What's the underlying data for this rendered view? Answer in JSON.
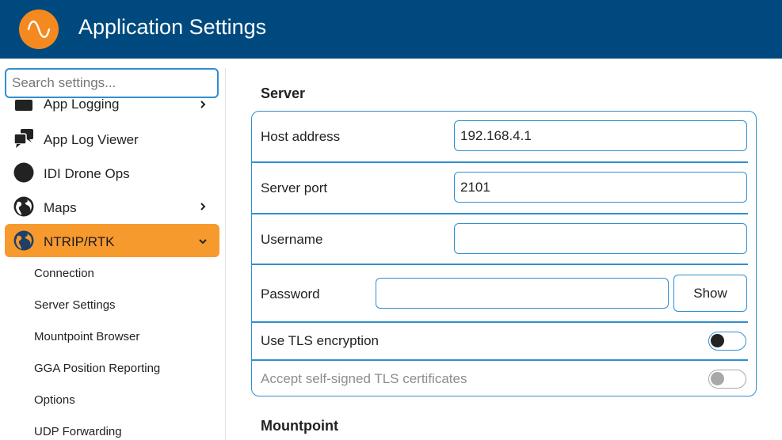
{
  "header": {
    "title": "Application Settings",
    "logo_icon": "sine-wave-icon",
    "bg_color": "#00497e",
    "logo_color": "#f48a1f"
  },
  "sidebar": {
    "search_placeholder": "Search settings...",
    "items": [
      {
        "label": "App Logging",
        "icon": "logging-icon",
        "has_chevron": true
      },
      {
        "label": "App Log Viewer",
        "icon": "chat-bubbles-icon",
        "has_chevron": false
      },
      {
        "label": "IDI Drone Ops",
        "icon": "circle-icon",
        "has_chevron": false
      },
      {
        "label": "Maps",
        "icon": "globe-icon",
        "has_chevron": true
      },
      {
        "label": "NTRIP/RTK",
        "icon": "globe-icon",
        "has_chevron": true,
        "expanded": true,
        "active": true
      }
    ],
    "subitems": [
      "Connection",
      "Server Settings",
      "Mountpoint Browser",
      "GGA Position Reporting",
      "Options",
      "UDP Forwarding"
    ],
    "active_color": "#f79a2e"
  },
  "main": {
    "server_section_title": "Server",
    "mountpoint_section_title": "Mountpoint",
    "host_label": "Host address",
    "host_value": "192.168.4.1",
    "port_label": "Server port",
    "port_value": "2101",
    "username_label": "Username",
    "username_value": "",
    "password_label": "Password",
    "password_value": "",
    "show_label": "Show",
    "tls_label": "Use TLS encryption",
    "tls_enabled": false,
    "selfsigned_label": "Accept self-signed TLS certificates",
    "selfsigned_enabled": false,
    "accent_color": "#2f8fd0"
  }
}
